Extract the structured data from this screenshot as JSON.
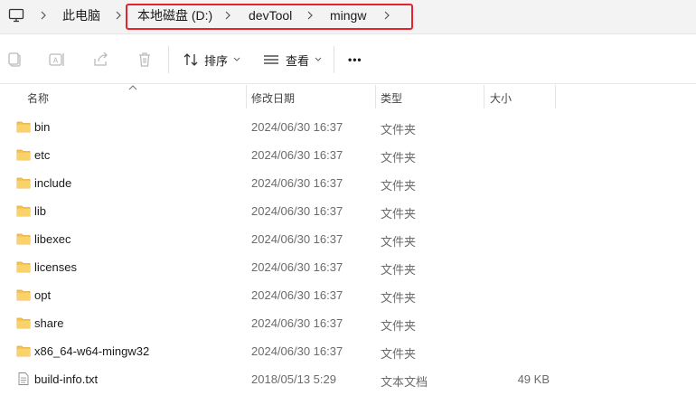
{
  "address_bar": {
    "root_icon": "computer-icon",
    "crumbs": [
      "此电脑",
      "本地磁盘 (D:)",
      "devTool",
      "mingw"
    ],
    "highlight_color": "#e8232f"
  },
  "toolbar": {
    "icons": [
      "copy-icon",
      "rename-icon",
      "share-icon",
      "delete-icon"
    ],
    "sort_label": "排序",
    "view_label": "查看",
    "more_label": "•••"
  },
  "columns": {
    "name": "名称",
    "date": "修改日期",
    "type": "类型",
    "size": "大小"
  },
  "files": [
    {
      "name": "bin",
      "date": "2024/06/30 16:37",
      "type": "文件夹",
      "size": "",
      "icon": "folder-icon"
    },
    {
      "name": "etc",
      "date": "2024/06/30 16:37",
      "type": "文件夹",
      "size": "",
      "icon": "folder-icon"
    },
    {
      "name": "include",
      "date": "2024/06/30 16:37",
      "type": "文件夹",
      "size": "",
      "icon": "folder-icon"
    },
    {
      "name": "lib",
      "date": "2024/06/30 16:37",
      "type": "文件夹",
      "size": "",
      "icon": "folder-icon"
    },
    {
      "name": "libexec",
      "date": "2024/06/30 16:37",
      "type": "文件夹",
      "size": "",
      "icon": "folder-icon"
    },
    {
      "name": "licenses",
      "date": "2024/06/30 16:37",
      "type": "文件夹",
      "size": "",
      "icon": "folder-icon"
    },
    {
      "name": "opt",
      "date": "2024/06/30 16:37",
      "type": "文件夹",
      "size": "",
      "icon": "folder-icon"
    },
    {
      "name": "share",
      "date": "2024/06/30 16:37",
      "type": "文件夹",
      "size": "",
      "icon": "folder-icon"
    },
    {
      "name": "x86_64-w64-mingw32",
      "date": "2024/06/30 16:37",
      "type": "文件夹",
      "size": "",
      "icon": "folder-icon"
    },
    {
      "name": "build-info.txt",
      "date": "2018/05/13 5:29",
      "type": "文本文档",
      "size": "49 KB",
      "icon": "text-file-icon"
    }
  ],
  "colors": {
    "folder": "#f6c44f",
    "folder_dark": "#e7a93a"
  }
}
